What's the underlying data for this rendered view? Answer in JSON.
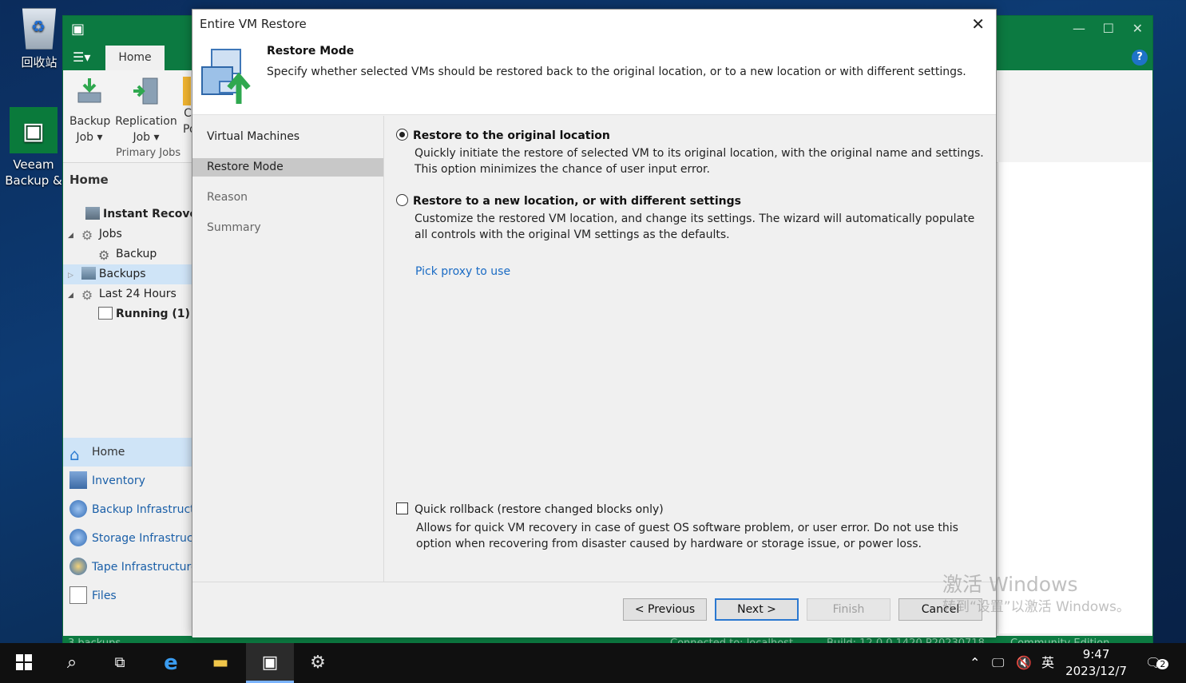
{
  "desktop": {
    "recycle_label": "回收站",
    "veeam_label_1": "Veeam",
    "veeam_label_2": "Backup &"
  },
  "app": {
    "home_tab": "Home",
    "ribbon": {
      "backup_job_1": "Backup",
      "backup_job_2": "Job ▾",
      "replication_job_1": "Replication",
      "replication_job_2": "Job ▾",
      "cut_3": "C",
      "cut_4": "Po",
      "group": "Primary Jobs"
    },
    "tree_head": "Home",
    "tree": [
      {
        "label": "Instant Recover",
        "bold": true
      },
      {
        "label": "Jobs"
      },
      {
        "label": "Backup"
      },
      {
        "label": "Backups"
      },
      {
        "label": "Last 24 Hours"
      },
      {
        "label": "Running (1)",
        "bold": true
      }
    ],
    "nav": [
      {
        "label": "Home"
      },
      {
        "label": "Inventory"
      },
      {
        "label": "Backup Infrastructu"
      },
      {
        "label": "Storage Infrastruct"
      },
      {
        "label": "Tape Infrastructure"
      },
      {
        "label": "Files"
      }
    ],
    "status": {
      "left": "3 backups",
      "connected": "Connected to: localhost",
      "build": "Build: 12.0.0.1420 P20230718",
      "edition": "Community Edition"
    }
  },
  "dialog": {
    "title": "Entire VM Restore",
    "header_title": "Restore Mode",
    "header_desc": "Specify whether selected VMs should be restored back to the original location, or to a new location or with different settings.",
    "steps": [
      "Virtual Machines",
      "Restore Mode",
      "Reason",
      "Summary"
    ],
    "option1": {
      "title": "Restore to the original location",
      "desc": "Quickly initiate the restore of selected VM to its original location, with the original name and settings. This option minimizes the chance of user input error."
    },
    "option2": {
      "title": "Restore to a new location, or with different settings",
      "desc": "Customize the restored VM location, and change its settings. The wizard will automatically populate all controls with the original VM settings as the defaults."
    },
    "proxy_link": "Pick proxy to use",
    "rollback": {
      "label": "Quick rollback (restore changed blocks only)",
      "desc": "Allows for quick VM recovery in case of guest OS software problem, or user error. Do not use this option when recovering from disaster caused by hardware or storage issue, or power loss."
    },
    "buttons": {
      "previous": "< Previous",
      "next": "Next >",
      "finish": "Finish",
      "cancel": "Cancel"
    }
  },
  "watermark": {
    "line1": "激活 Windows",
    "line2": "转到“设置”以激活 Windows。"
  },
  "taskbar": {
    "ime": "英",
    "time": "9:47",
    "date": "2023/12/7",
    "notif_count": "2"
  },
  "colors": {
    "veeam_green": "#0c7a41",
    "link_blue": "#1a6bc4",
    "selection_blue": "#cfe4f7"
  }
}
